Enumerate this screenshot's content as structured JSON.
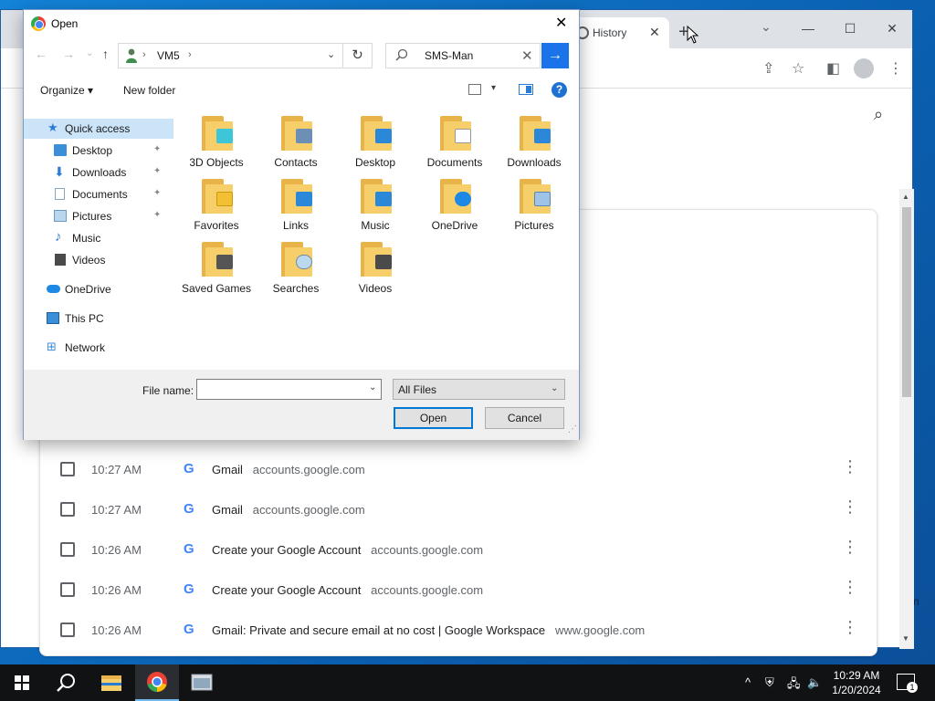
{
  "chrome": {
    "tab_title": "History",
    "tab_close": "✕",
    "new_tab": "+",
    "tab_search": "⌄",
    "window": {
      "minimize": "—",
      "maximize": "☐",
      "close": "✕"
    },
    "toolbar_icons": {
      "share": "⇪",
      "star": "☆",
      "sidepanel": "◧",
      "menu": "⋮"
    },
    "history_search_icon": "⌕"
  },
  "history": {
    "rows": [
      {
        "time": "10:27 AM",
        "favicon": "G",
        "title": "Gmail",
        "domain": "accounts.google.com"
      },
      {
        "time": "10:27 AM",
        "favicon": "G",
        "title": "Gmail",
        "domain": "accounts.google.com"
      },
      {
        "time": "10:26 AM",
        "favicon": "G",
        "title": "Create your Google Account",
        "domain": "accounts.google.com"
      },
      {
        "time": "10:26 AM",
        "favicon": "G",
        "title": "Create your Google Account",
        "domain": "accounts.google.com"
      },
      {
        "time": "10:26 AM",
        "favicon": "G",
        "title": "Gmail: Private and secure email at no cost | Google Workspace",
        "domain": "www.google.com"
      }
    ],
    "row_menu": "⋮"
  },
  "dialog": {
    "title": "Open",
    "close": "✕",
    "nav": {
      "back": "←",
      "forward": "→",
      "recent": "⌄",
      "up": "↑"
    },
    "address": {
      "crumb_sep": "›",
      "location": "VM5",
      "dropdown": "⌄",
      "refresh": "↻"
    },
    "search": {
      "value": "SMS-Man",
      "clear": "✕",
      "go": "→"
    },
    "commands": {
      "organize": "Organize ▾",
      "new_folder": "New folder",
      "view_drop": "▾",
      "help": "?"
    },
    "nav_pane": [
      {
        "label": "Quick access",
        "icon": "star-icon",
        "color": "#2b7bd3"
      },
      {
        "label": "Desktop",
        "icon": "desktop-icon",
        "color": "#3b8ed8",
        "pinned": "📌"
      },
      {
        "label": "Downloads",
        "icon": "download-icon",
        "color": "#2b7bd3",
        "pinned": "📌"
      },
      {
        "label": "Documents",
        "icon": "document-icon",
        "color": "#8aa4c0",
        "pinned": "📌"
      },
      {
        "label": "Pictures",
        "icon": "picture-icon",
        "color": "#6a9ac8",
        "pinned": "📌"
      },
      {
        "label": "Music",
        "icon": "music-icon",
        "color": "#2b7bd3"
      },
      {
        "label": "Videos",
        "icon": "video-icon",
        "color": "#5a5a5a"
      },
      {
        "label": "OneDrive",
        "icon": "onedrive-icon",
        "color": "#1e88e5"
      },
      {
        "label": "This PC",
        "icon": "computer-icon",
        "color": "#3b8ed8"
      },
      {
        "label": "Network",
        "icon": "network-icon",
        "color": "#3b8ed8"
      }
    ],
    "folders": [
      {
        "label": "3D Objects",
        "badge": "#3cc6d8"
      },
      {
        "label": "Contacts",
        "badge": "#6d8fb5"
      },
      {
        "label": "Desktop",
        "badge": "#2b87d8"
      },
      {
        "label": "Documents",
        "badge": "#ffffff"
      },
      {
        "label": "Downloads",
        "badge": "#2b87d8"
      },
      {
        "label": "Favorites",
        "badge": "#f3c033"
      },
      {
        "label": "Links",
        "badge": "#2b87d8"
      },
      {
        "label": "Music",
        "badge": "#2b87d8"
      },
      {
        "label": "OneDrive",
        "badge": "#1e88e5"
      },
      {
        "label": "Pictures",
        "badge": "#9ec3e6"
      },
      {
        "label": "Saved Games",
        "badge": "#555555"
      },
      {
        "label": "Searches",
        "badge": "#bcd8ee"
      },
      {
        "label": "Videos",
        "badge": "#4a4a4a"
      }
    ],
    "file_name_label": "File name:",
    "file_name_value": "",
    "file_name_drop": "⌄",
    "filter_value": "All Files",
    "filter_drop": "⌄",
    "open_label": "Open",
    "cancel_label": "Cancel",
    "grip": "⋰"
  },
  "taskbar": {
    "time": "10:29 AM",
    "date": "1/20/2024",
    "notification_count": "1",
    "tray": {
      "chevron": "^",
      "volume": "🔈",
      "network": "🖧"
    }
  },
  "desktop": {
    "edge_letter": "n"
  },
  "colors": {
    "accent": "#0078d7",
    "selection": "#cce4f7",
    "folder": "#f6cf6b",
    "taskbar": "#101214"
  }
}
